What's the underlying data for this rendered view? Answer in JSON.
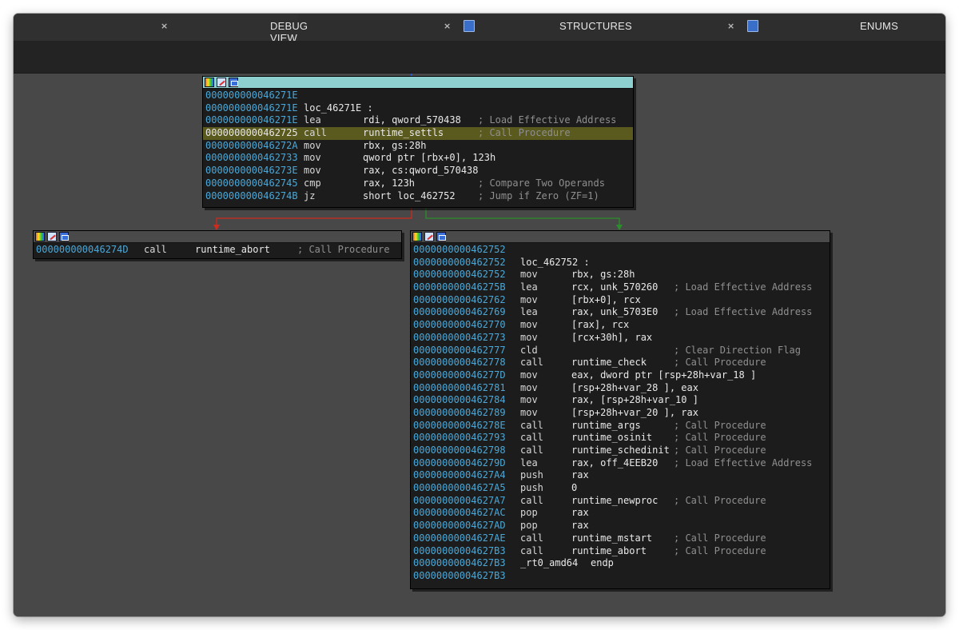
{
  "tabs": [
    {
      "label": "DEBUG VIEW",
      "close": "×",
      "icon": "none",
      "active": true
    },
    {
      "label": "STRUCTURES",
      "close": "×",
      "icon": "structures-icon",
      "active": false
    },
    {
      "label": "ENUMS",
      "close": "×",
      "icon": "enums-icon",
      "active": false
    }
  ],
  "colors": {
    "edge_false": "#d02a1f",
    "edge_true": "#2a8f2a",
    "address": "#4aa8d8",
    "selected_header": "#8ecfcf",
    "highlight": "#5a5a1e"
  },
  "blocks": {
    "top": {
      "rows": [
        {
          "addr": "000000000046271E",
          "mn": "",
          "op": "",
          "cm": ""
        },
        {
          "addr": "000000000046271E",
          "mn": "loc_46271E :",
          "op": "",
          "cm": ""
        },
        {
          "addr": "000000000046271E",
          "mn": "lea",
          "op": "rdi, qword_570438",
          "cm": "; Load Effective Address"
        },
        {
          "addr": "0000000000462725",
          "mn": "call",
          "op": "runtime_settls",
          "cm": "; Call Procedure"
        },
        {
          "addr": "000000000046272A",
          "mn": "mov",
          "op": "rbx, gs:28h",
          "cm": ""
        },
        {
          "addr": "0000000000462733",
          "mn": "mov",
          "op": "qword ptr [rbx+0], 123h",
          "cm": ""
        },
        {
          "addr": "000000000046273E",
          "mn": "mov",
          "op": "rax, cs:qword_570438",
          "cm": ""
        },
        {
          "addr": "0000000000462745",
          "mn": "cmp",
          "op": "rax, 123h",
          "cm": "; Compare Two Operands"
        },
        {
          "addr": "000000000046274B",
          "mn": "jz",
          "op": "short loc_462752",
          "cm": "; Jump if Zero (ZF=1)"
        }
      ]
    },
    "left": {
      "rows": [
        {
          "addr": "000000000046274D",
          "mn": "call",
          "op": "runtime_abort",
          "cm": "; Call Procedure"
        }
      ]
    },
    "right": {
      "rows": [
        {
          "addr": "0000000000462752",
          "mn": "",
          "op": "",
          "cm": ""
        },
        {
          "addr": "0000000000462752",
          "mn": "loc_462752 :",
          "op": "",
          "cm": ""
        },
        {
          "addr": "0000000000462752",
          "mn": "mov",
          "op": "rbx, gs:28h",
          "cm": ""
        },
        {
          "addr": "000000000046275B",
          "mn": "lea",
          "op": "rcx, unk_570260",
          "cm": "; Load Effective Address"
        },
        {
          "addr": "0000000000462762",
          "mn": "mov",
          "op": "[rbx+0], rcx",
          "cm": ""
        },
        {
          "addr": "0000000000462769",
          "mn": "lea",
          "op": "rax, unk_5703E0",
          "cm": "; Load Effective Address"
        },
        {
          "addr": "0000000000462770",
          "mn": "mov",
          "op": "[rax], rcx",
          "cm": ""
        },
        {
          "addr": "0000000000462773",
          "mn": "mov",
          "op": "[rcx+30h], rax",
          "cm": ""
        },
        {
          "addr": "0000000000462777",
          "mn": "cld",
          "op": "",
          "cm": "; Clear Direction Flag"
        },
        {
          "addr": "0000000000462778",
          "mn": "call",
          "op": "runtime_check",
          "cm": "; Call Procedure"
        },
        {
          "addr": "000000000046277D",
          "mn": "mov",
          "op": "eax, dword ptr [rsp+28h+var_18 ]",
          "cm": ""
        },
        {
          "addr": "0000000000462781",
          "mn": "mov",
          "op": "[rsp+28h+var_28 ], eax",
          "cm": ""
        },
        {
          "addr": "0000000000462784",
          "mn": "mov",
          "op": "rax, [rsp+28h+var_10 ]",
          "cm": ""
        },
        {
          "addr": "0000000000462789",
          "mn": "mov",
          "op": "[rsp+28h+var_20 ], rax",
          "cm": ""
        },
        {
          "addr": "000000000046278E",
          "mn": "call",
          "op": "runtime_args",
          "cm": "; Call Procedure"
        },
        {
          "addr": "0000000000462793",
          "mn": "call",
          "op": "runtime_osinit",
          "cm": "; Call Procedure"
        },
        {
          "addr": "0000000000462798",
          "mn": "call",
          "op": "runtime_schedinit",
          "cm": "; Call Procedure"
        },
        {
          "addr": "000000000046279D",
          "mn": "lea",
          "op": "rax, off_4EEB20",
          "cm": "; Load Effective Address"
        },
        {
          "addr": "00000000004627A4",
          "mn": "push",
          "op": "rax",
          "cm": ""
        },
        {
          "addr": "00000000004627A5",
          "mn": "push",
          "op": "0",
          "cm": ""
        },
        {
          "addr": "00000000004627A7",
          "mn": "call",
          "op": "runtime_newproc",
          "cm": "; Call Procedure"
        },
        {
          "addr": "00000000004627AC",
          "mn": "pop",
          "op": "rax",
          "cm": ""
        },
        {
          "addr": "00000000004627AD",
          "mn": "pop",
          "op": "rax",
          "cm": ""
        },
        {
          "addr": "00000000004627AE",
          "mn": "call",
          "op": "runtime_mstart",
          "cm": "; Call Procedure"
        },
        {
          "addr": "00000000004627B3",
          "mn": "call",
          "op": "runtime_abort",
          "cm": "; Call Procedure"
        },
        {
          "addr": "00000000004627B3",
          "mn": "_rt0_amd64",
          "op": "endp",
          "cm": ""
        },
        {
          "addr": "00000000004627B3",
          "mn": "",
          "op": "",
          "cm": ""
        }
      ]
    }
  }
}
